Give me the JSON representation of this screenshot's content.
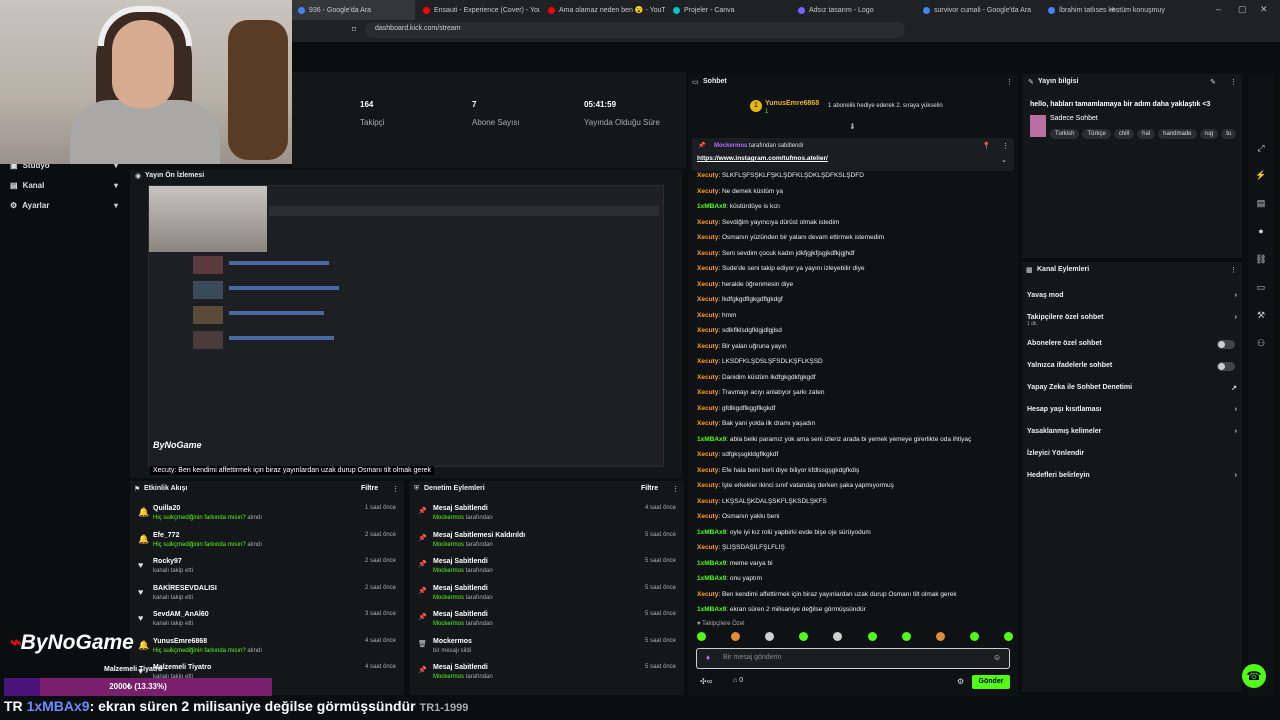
{
  "browser": {
    "tabs": [
      {
        "title": "936 - Google'da Ara",
        "color": "#4285f4"
      },
      {
        "title": "Ensauti - Experience (Cover) - YouTu",
        "color": "#ff0000"
      },
      {
        "title": "Ama olamaz neden ben 😮 - YouTu",
        "color": "#ff0000"
      },
      {
        "title": "Projeler - Canva",
        "color": "#00c4cc"
      },
      {
        "title": "Adsız tasarım - Logo",
        "color": "#7b61ff"
      },
      {
        "title": "survivor cumali - Google'da Ara",
        "color": "#4285f4"
      },
      {
        "title": "İbrahim tatlıses kostüm konuşmuyo",
        "color": "#4285f4"
      }
    ],
    "new_tab": "+",
    "url": "dashboard.kick.com/stream"
  },
  "stats": {
    "followers_value": "164",
    "followers_label": "Takipçi",
    "subs_value": "7",
    "subs_label": "Abone Sayısı",
    "uptime_value": "05:41:59",
    "uptime_label": "Yayında Olduğu Süre"
  },
  "nav": {
    "studio": "Stüdyo",
    "channel": "Kanal",
    "settings": "Ayarlar"
  },
  "preview": {
    "title": "Yayın Ön İzlemesi",
    "caption": "Xecuty: Ben kendimi affettirmek için biraz yayınlardan uzak durup Osmanı tilt olmak gerek",
    "watermark": "ByNoGame"
  },
  "activity": {
    "title": "Etkinlik Akışı",
    "filter": "Filtre",
    "rows": [
      {
        "name": "Quilla20",
        "pre": "Hiç suikçmediğinin farkında mısın?",
        "post": " alındı",
        "time": "1 saat önce",
        "icon": "🔔"
      },
      {
        "name": "Efe_772",
        "pre": "Hiç suikçmediğinin farkında mısın?",
        "post": " alındı",
        "time": "2 saat önce",
        "icon": "🔔"
      },
      {
        "name": "Rocky97",
        "pre": "",
        "post": "kanalı takip etti",
        "time": "2 saat önce",
        "icon": "♥"
      },
      {
        "name": "BAKİRESEVDALISI",
        "pre": "",
        "post": "kanalı takip etti",
        "time": "2 saat önce",
        "icon": "♥"
      },
      {
        "name": "SevdAM_AnAl60",
        "pre": "",
        "post": "kanalı takip etti",
        "time": "3 saat önce",
        "icon": "♥"
      },
      {
        "name": "YunusEmre6868",
        "pre": "Hiç suikçmediğinin farkında mısın?",
        "post": " alındı",
        "time": "4 saat önce",
        "icon": "🔔"
      },
      {
        "name": "Malzemeli Tiyatro",
        "pre": "",
        "post": "kanalı takip etti",
        "time": "4 saat önce",
        "icon": "♥"
      }
    ]
  },
  "modlog": {
    "title": "Denetim Eylemleri",
    "filter": "Filtre",
    "rows": [
      {
        "action": "Mesaj Sabitlendi",
        "by": "Mockermos",
        "suffix": " tarafından",
        "time": "4 saat önce",
        "icon": "📌"
      },
      {
        "action": "Mesaj Sabitlemesi Kaldırıldı",
        "by": "Mockermos",
        "suffix": " tarafından",
        "time": "5 saat önce",
        "icon": "📌"
      },
      {
        "action": "Mesaj Sabitlendi",
        "by": "Mockermos",
        "suffix": " tarafından",
        "time": "5 saat önce",
        "icon": "📌"
      },
      {
        "action": "Mesaj Sabitlendi",
        "by": "Mockermos",
        "suffix": " tarafından",
        "time": "5 saat önce",
        "icon": "📌"
      },
      {
        "action": "Mesaj Sabitlendi",
        "by": "Mockermos",
        "suffix": " tarafından",
        "time": "5 saat önce",
        "icon": "📌"
      },
      {
        "action": "Mockermos",
        "by": "",
        "suffix": "bir mesajı sildi",
        "time": "5 saat önce",
        "icon": "🗑"
      },
      {
        "action": "Mesaj Sabitlendi",
        "by": "Mockermos",
        "suffix": " tarafından",
        "time": "5 saat önce",
        "icon": "📌"
      }
    ]
  },
  "chat": {
    "title": "Sohbet",
    "gift_user": "YunusEmre6868",
    "gift_count": "1",
    "gift_text": "1 abonelik hediye ederek 2. sıraya yükselin",
    "pinned_by": "Mockermos",
    "pinned_by_suffix": " tarafından sabitlendi",
    "pinned_link": "https://www.instagram.com/tufmos.atelier/",
    "messages": [
      {
        "user": "Xecuty",
        "text": "SLKFLŞFSŞKLFŞKLŞDFKLŞDKLŞDFKSLŞDFD",
        "c": "or"
      },
      {
        "user": "Xecuty",
        "text": "Ne demek küstüm ya",
        "c": "or"
      },
      {
        "user": "1xMBAx9",
        "text": "küstürdüye is kızı",
        "c": "gr"
      },
      {
        "user": "Xecuty",
        "text": "Sevdiğim yayıncıya dürüst olmak istedim",
        "c": "or"
      },
      {
        "user": "Xecuty",
        "text": "Osmanın yüzünden bir yalanı devam ettirmek istemedim",
        "c": "or"
      },
      {
        "user": "Xecuty",
        "text": "Seni sevdim çocuk kadın jdkfjgjkfjsgjkdfkjgjhdf",
        "c": "or"
      },
      {
        "user": "Xecuty",
        "text": "Sude'de seni takip ediyor ya yayını izleyebilir diye",
        "c": "or"
      },
      {
        "user": "Xecuty",
        "text": "heralde öğrenmesin diye",
        "c": "or"
      },
      {
        "user": "Xecuty",
        "text": "lkdfgkgdflgkgdflgkdgf",
        "c": "or"
      },
      {
        "user": "Xecuty",
        "text": "hmm",
        "c": "or"
      },
      {
        "user": "Xecuty",
        "text": "sdlkflklsdgfklgjdlgjlsd",
        "c": "or"
      },
      {
        "user": "Xecuty",
        "text": "Bir yalan uğruna yayın",
        "c": "or"
      },
      {
        "user": "Xecuty",
        "text": "LKSDFKLŞDSLŞFSDLKŞFLKŞSD",
        "c": "or"
      },
      {
        "user": "Xecuty",
        "text": "Danidim küstüm lkdfgkgdkfgkgdf",
        "c": "or"
      },
      {
        "user": "Xecuty",
        "text": "Travmayı acıyı anlatıyor şarkı zaten",
        "c": "or"
      },
      {
        "user": "Xecuty",
        "text": "gfdlkgdflkggflkgkdf",
        "c": "or"
      },
      {
        "user": "Xecuty",
        "text": "Bak yani yolda ilk dramı yaşadın",
        "c": "or"
      },
      {
        "user": "1xMBAx9",
        "text": "abla belki paramız yok ama seni izleriz arada bi yemek yemeye girerlikte oda ihtiyaç",
        "c": "gr"
      },
      {
        "user": "Xecuty",
        "text": "sdfgkşsgkldgflkgkdf",
        "c": "or"
      },
      {
        "user": "Xecuty",
        "text": "Efe hala beni berli diye biliyor kfdlssgşgkdgfkdiş",
        "c": "or"
      },
      {
        "user": "Xecuty",
        "text": "İşte erkekler ikinci sınıf vatandaş derken şaka yapmıyormuş",
        "c": "or"
      },
      {
        "user": "Xecuty",
        "text": "LKŞSALŞKDALŞSKFLŞKSDLŞKFS",
        "c": "or"
      },
      {
        "user": "Xecuty",
        "text": "Osmanın yakkı beni",
        "c": "or"
      },
      {
        "user": "1xMBAx9",
        "text": "oyle iyi kız rolü yapbirki evde bişe oje sürüyodum",
        "c": "gr"
      },
      {
        "user": "Xecuty",
        "text": "ŞLİŞSDAŞİLFŞLFLİŞ",
        "c": "or"
      },
      {
        "user": "1xMBAx9",
        "text": "meme varya bi",
        "c": "gr"
      },
      {
        "user": "1xMBAx9",
        "text": "onu yaptım",
        "c": "gr"
      },
      {
        "user": "Xecuty",
        "text": "Ben kendimi affettirmek için biraz yayınlardan uzak durup Osmanı tilt olmak gerek",
        "c": "or"
      },
      {
        "user": "1xMBAx9",
        "text": "ekran süren 2 milisaniye değilse görmüşsündür",
        "c": "gr"
      }
    ],
    "followers_only": "Takipçilere Özel",
    "input_placeholder": "Bir mesaj gönderin",
    "points": "0",
    "send": "Gönder"
  },
  "stream_info": {
    "title": "Yayın bilgisi",
    "stream_title": "hello, habları tamamlamaya bir adım daha yaklaştık <3",
    "category": "Sadece Sohbet",
    "tags": [
      "Turkish",
      "Türkçe",
      "chill",
      "hal",
      "handmade",
      "rug",
      "tu"
    ]
  },
  "channel_actions": {
    "title": "Kanal Eylemleri",
    "items": [
      {
        "label": "Yavaş mod",
        "sub": "",
        "ctrl": "chevron"
      },
      {
        "label": "Takipçilere özel sohbet",
        "sub": "1 dk.",
        "ctrl": "chevron"
      },
      {
        "label": "Abonelere özel sohbet",
        "sub": "",
        "ctrl": "toggle"
      },
      {
        "label": "Yalnızca ifadelerle sohbet",
        "sub": "",
        "ctrl": "toggle"
      },
      {
        "label": "Yapay Zeka ile Sohbet Denetimi",
        "sub": "",
        "ctrl": "ext"
      },
      {
        "label": "Hesap yaşı kısıtlaması",
        "sub": "",
        "ctrl": "chevron"
      },
      {
        "label": "Yasaklanmış kelimeler",
        "sub": "",
        "ctrl": "chevron"
      },
      {
        "label": "İzleyici Yönlendir",
        "sub": "",
        "ctrl": ""
      },
      {
        "label": "Hedefleri belirleyin",
        "sub": "",
        "ctrl": "chevron"
      }
    ]
  },
  "overlay": {
    "logo": "ByNoGame",
    "goal_label": "Malzemeli Tiyatro",
    "goal_text": "2000₺ (13.33%)",
    "goal_fraction": 0.1333,
    "ticker_prefix": "TR",
    "ticker_user": "1xMBAx9",
    "ticker_text": ": ekran süren 2 milisaniye değilse görmüşsündür",
    "ticker_suffix": "TR1-1999"
  },
  "colors": {
    "accent": "#53fc18",
    "orange": "#ff9e1f",
    "panel": "#14171a"
  }
}
